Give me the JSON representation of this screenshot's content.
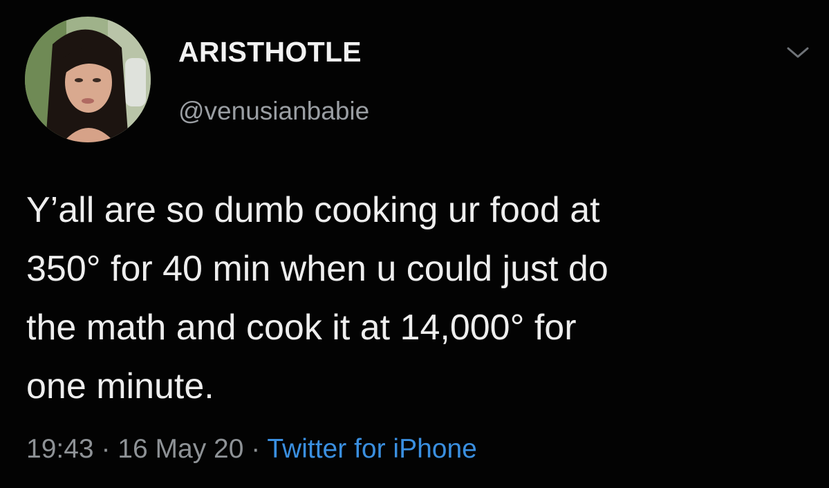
{
  "tweet": {
    "avatar_icon": "profile-photo",
    "display_name": "ARISTHOTLE",
    "handle": "@venusianbabie",
    "menu_icon": "chevron-down-icon",
    "text_lines": [
      "Y’all are so dumb cooking ur food at",
      "350° for 40 min when u could just do",
      "the math and cook it at 14,000° for",
      "one minute."
    ],
    "time": "19:43",
    "separator": "·",
    "date": "16 May 20",
    "source": "Twitter for iPhone"
  },
  "colors": {
    "background": "#030303",
    "text": "#eeeeee",
    "muted": "#9a9ea3",
    "link": "#3a8fe0"
  }
}
